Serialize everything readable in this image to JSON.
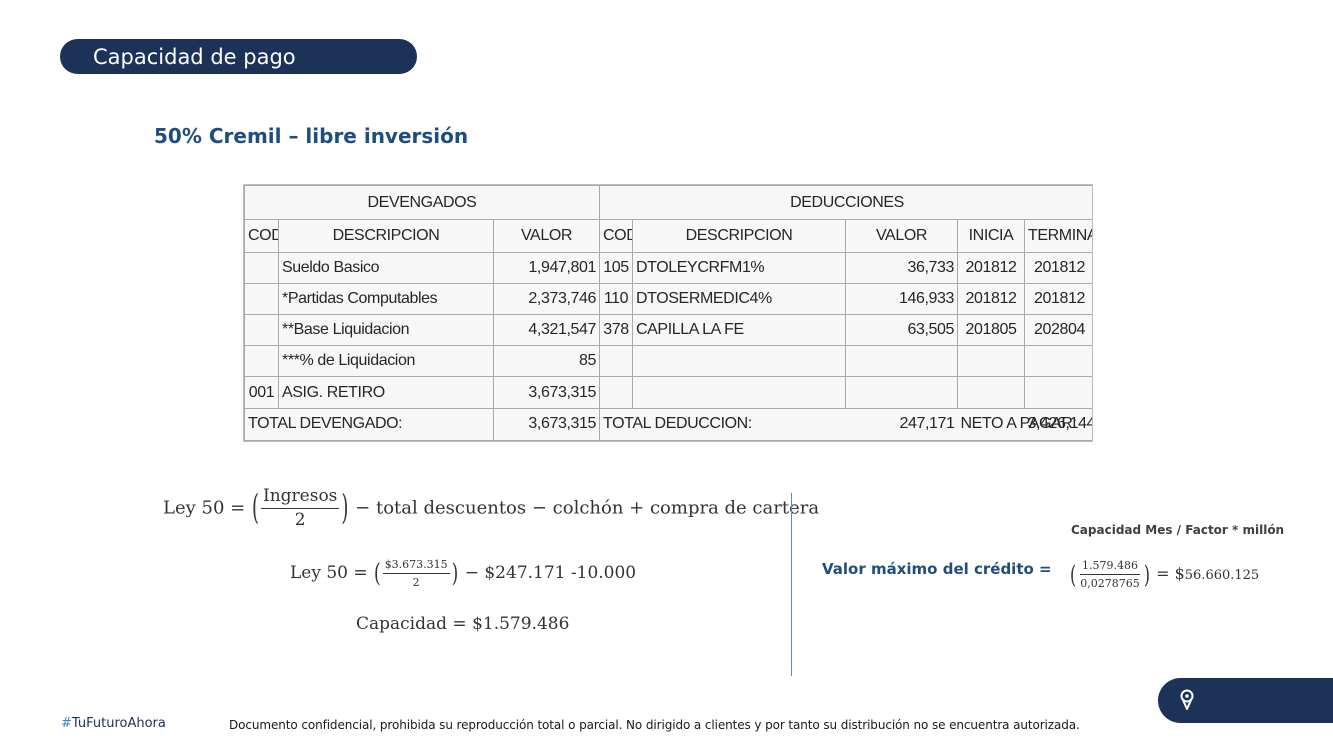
{
  "title": "Capacidad de pago",
  "subtitle": "50% Cremil – libre inversión",
  "payslip": {
    "devengados_header": "DEVENGADOS",
    "deducciones_header": "DEDUCCIONES",
    "columns": {
      "cod": "COD",
      "descripcion": "DESCRIPCION",
      "valor": "VALOR",
      "inicia": "INICIA",
      "termina": "TERMINA"
    },
    "rows": [
      {
        "dev_cod": "",
        "dev_desc": "Sueldo Basico",
        "dev_valor": "1,947,801",
        "ded_cod": "105",
        "ded_desc": "DTOLEYCRFM1%",
        "ded_valor": "36,733",
        "inicia": "201812",
        "termina": "201812"
      },
      {
        "dev_cod": "",
        "dev_desc": "*Partidas Computables",
        "dev_valor": "2,373,746",
        "ded_cod": "110",
        "ded_desc": "DTOSERMEDIC4%",
        "ded_valor": "146,933",
        "inicia": "201812",
        "termina": "201812"
      },
      {
        "dev_cod": "",
        "dev_desc": "**Base Liquidacion",
        "dev_valor": "4,321,547",
        "ded_cod": "378",
        "ded_desc": "CAPILLA LA FE",
        "ded_valor": "63,505",
        "inicia": "201805",
        "termina": "202804"
      },
      {
        "dev_cod": "",
        "dev_desc": "***% de Liquidacion",
        "dev_valor": "85",
        "ded_cod": "",
        "ded_desc": "",
        "ded_valor": "",
        "inicia": "",
        "termina": ""
      },
      {
        "dev_cod": "001",
        "dev_desc": "ASIG. RETIRO",
        "dev_valor": "3,673,315",
        "ded_cod": "",
        "ded_desc": "",
        "ded_valor": "",
        "inicia": "",
        "termina": ""
      }
    ],
    "totals": {
      "devengado_label": "TOTAL DEVENGADO:",
      "devengado_value": "3,673,315",
      "deduccion_label": "TOTAL DEDUCCION:",
      "deduccion_value": "247,171",
      "neto_label": "NETO A PAGAR:",
      "neto_value": "3,426,144"
    }
  },
  "formulas": {
    "f1": {
      "lhs": "Ley 50 =",
      "num": "Ingresos",
      "den": "2",
      "rest": "− total descuentos − colchón + compra de cartera"
    },
    "f2": {
      "lhs": "Ley 50 =",
      "num": "$3.673.315",
      "den": "2",
      "rest": "− $247.171 -10.000"
    },
    "f3": {
      "text": "Capacidad = $1.579.486"
    }
  },
  "credit": {
    "label": "Valor máximo del crédito  =",
    "note": "Capacidad Mes / Factor * millón",
    "num": "1.579.486",
    "den": "0,0278765",
    "equals": "= $",
    "result": "56.660.125"
  },
  "footer": {
    "hash": "#",
    "hashtag": "TuFuturoAhora",
    "disclaimer": "Documento confidencial, prohibida su reproducción  total o parcial. No dirigido a clientes y por tanto su distribución no se encuentra autorizada.",
    "icon": "location-pin-icon"
  },
  "colors": {
    "navy": "#1c3257",
    "accent_text": "#1f4e7d",
    "divider": "#5b8bbf"
  }
}
